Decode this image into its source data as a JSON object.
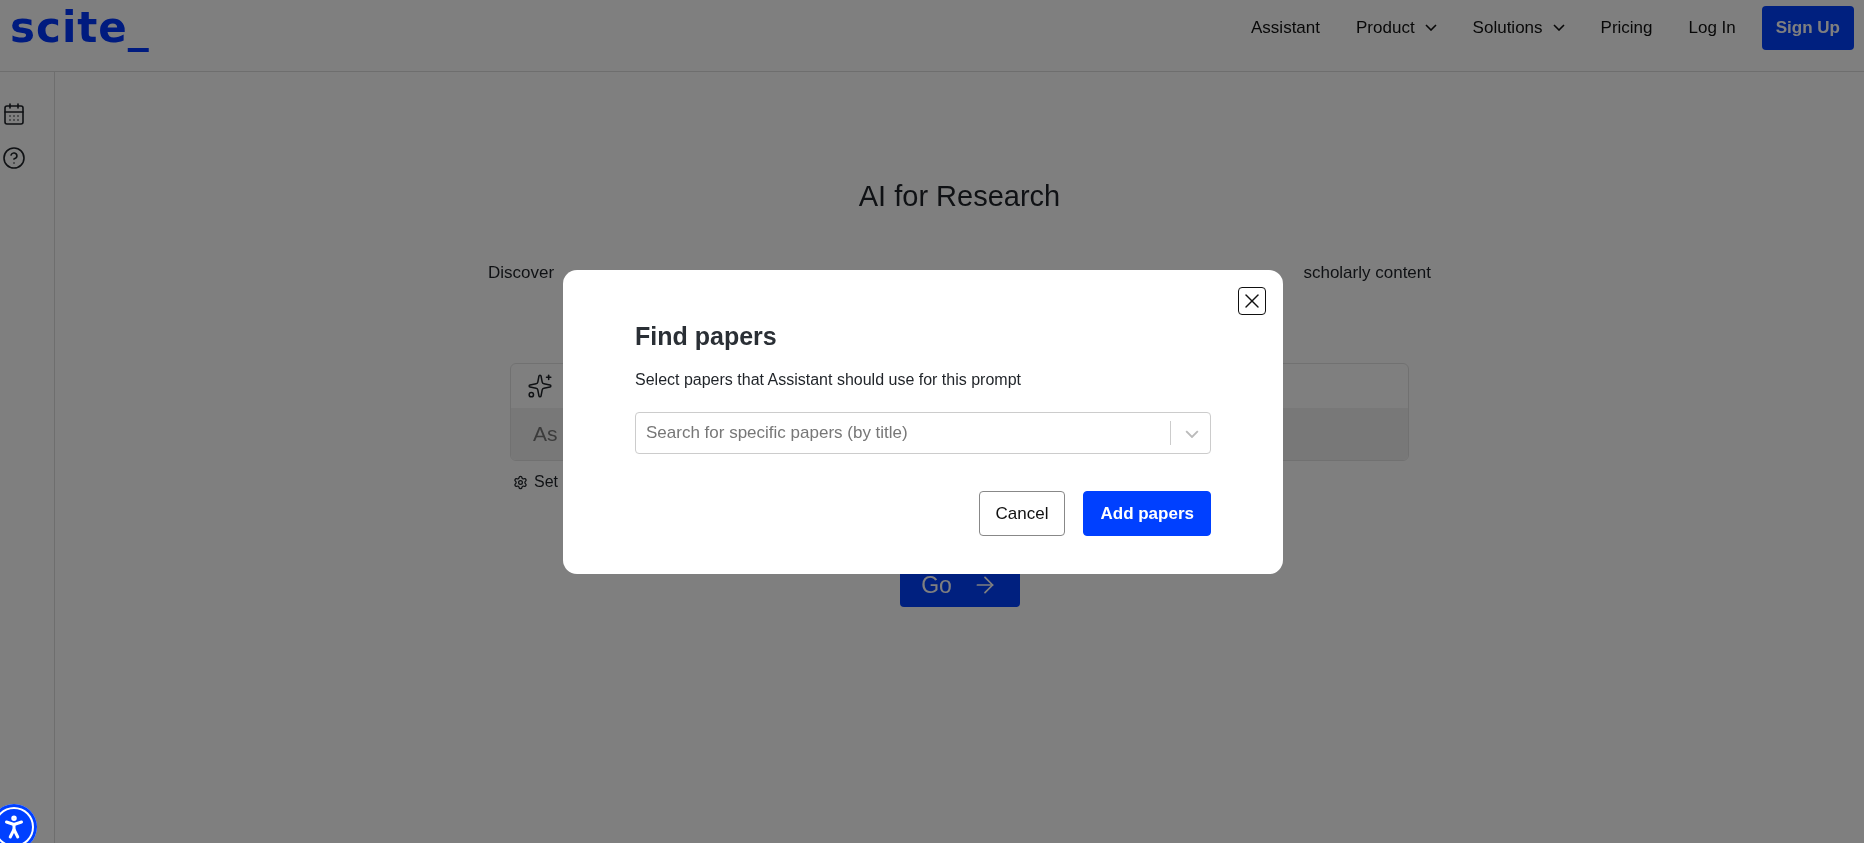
{
  "header": {
    "logo": "scite_",
    "nav": [
      {
        "label": "Assistant",
        "dropdown": false
      },
      {
        "label": "Product",
        "dropdown": true
      },
      {
        "label": "Solutions",
        "dropdown": true
      },
      {
        "label": "Pricing",
        "dropdown": false
      },
      {
        "label": "Log In",
        "dropdown": false
      }
    ],
    "signup": "Sign Up"
  },
  "main": {
    "title": "AI for Research",
    "description_start": "Discover",
    "description_end": "scholarly content",
    "prompt_placeholder": "As",
    "settings_label": "Set",
    "go_button": "Go"
  },
  "modal": {
    "title": "Find papers",
    "subtitle": "Select papers that Assistant should use for this prompt",
    "search": {
      "placeholder": "Search for specific papers (by title)"
    },
    "buttons": [
      {
        "label": "Cancel",
        "kind": "secondary"
      },
      {
        "label": "Add papers",
        "kind": "primary"
      }
    ]
  }
}
